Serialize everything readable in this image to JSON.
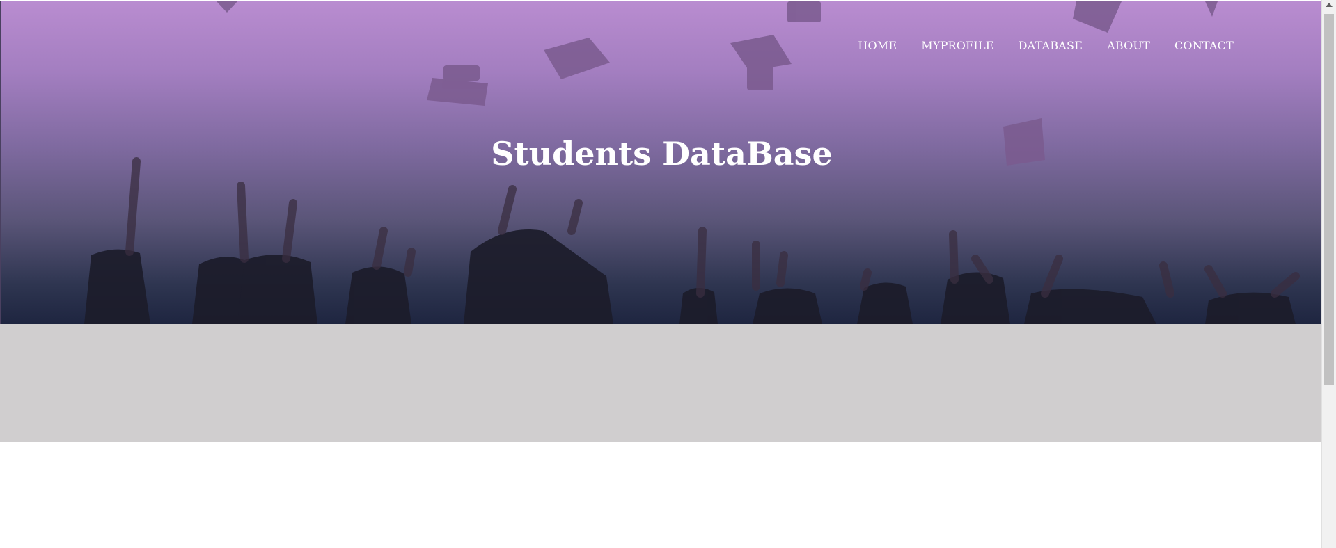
{
  "nav": {
    "items": [
      {
        "label": "HOME"
      },
      {
        "label": "MYPROFILE"
      },
      {
        "label": "DATABASE"
      },
      {
        "label": "ABOUT"
      },
      {
        "label": "CONTACT"
      }
    ]
  },
  "hero": {
    "title": "Students DataBase",
    "image_description": "graduates throwing caps"
  },
  "colors": {
    "hero_top": "#b98cd0",
    "hero_bottom": "#1e2540",
    "band": "#d0cecf",
    "text": "#ffffff"
  }
}
